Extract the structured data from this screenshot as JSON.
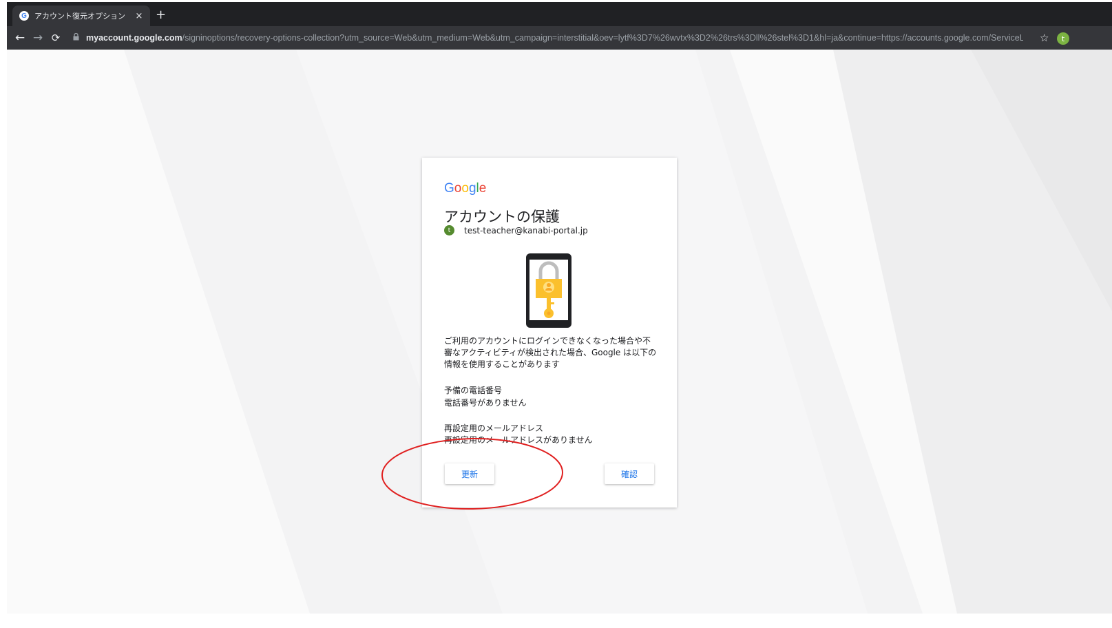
{
  "browser": {
    "tab_title": "アカウント復元オプション",
    "tab_close": "×",
    "new_tab": "+",
    "url_host": "myaccount.google.com",
    "url_path": "/signinoptions/recovery-options-collection?utm_source=Web&utm_medium=Web&utm_campaign=interstitial&oev=lytf%3D7%26wvtx%3D2%26trs%3Dll%26stel%3D1&hl=ja&continue=https://accounts.google.com/ServiceLogin...",
    "profile_initial": "t"
  },
  "card": {
    "logo_letters": [
      "G",
      "o",
      "o",
      "g",
      "l",
      "e"
    ],
    "logo_colors": [
      "#4285F4",
      "#EA4335",
      "#FBBC05",
      "#4285F4",
      "#34A853",
      "#EA4335"
    ],
    "heading": "アカウントの保護",
    "avatar_initial": "t",
    "email": "test-teacher@kanabi-portal.jp",
    "description": "ご利用のアカウントにログインできなくなった場合や不審なアクティビティが検出された場合、Google は以下の情報を使用することがあります",
    "phone_title": "予備の電話番号",
    "phone_value": "電話番号がありません",
    "email_title": "再設定用のメールアドレス",
    "email_value": "再設定用のメールアドレスがありません",
    "update_button": "更新",
    "confirm_button": "確認"
  },
  "colors": {
    "accent": "#1a73e8",
    "annotation": "#e02020",
    "lock_yellow": "#fbc02d"
  }
}
